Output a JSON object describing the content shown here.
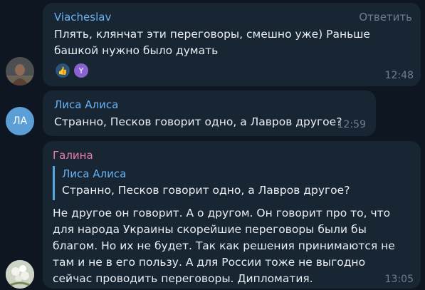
{
  "messages": [
    {
      "author": "Viacheslav",
      "author_color": "#6ab2f2",
      "text": "Плять, клянчат эти переговоры, смешно уже) Раньше башкой нужно было думать",
      "reply_action": "Ответить",
      "time": "12:48",
      "reactions": [
        "thumbs-up-icon",
        "Y"
      ]
    },
    {
      "author": "Лиса Алиса",
      "author_color": "#6ab2f2",
      "avatar_initials": "ЛА",
      "avatar_color": "#5c9fd6",
      "text": "Странно, Песков говорит одно, а Лавров другое?",
      "time": "12:59"
    },
    {
      "author": "Галина",
      "author_color": "#ee7aae",
      "quote": {
        "author": "Лиса Алиса",
        "text": "Странно, Песков говорит одно, а Лавров другое?"
      },
      "text": "Не другое он говорит. А о другом. Он говорит про то, что для народа Украины скорейшие переговоры были бы благом. Но их не будет. Так как решения принимаются не  там и не в его пользу. А для России тоже не выгодно сейчас проводить переговоры. Дипломатия.",
      "time": "13:05"
    }
  ]
}
